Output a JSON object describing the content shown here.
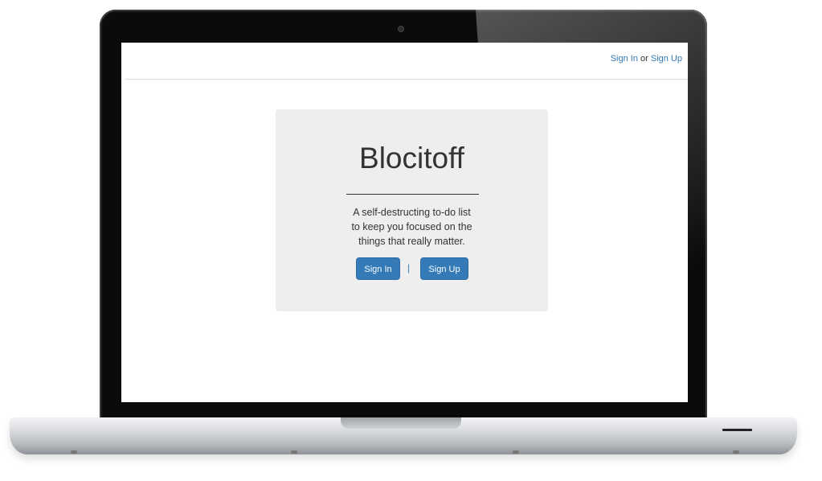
{
  "header": {
    "signin_link": "Sign In",
    "or_text": "or",
    "signup_link": "Sign Up"
  },
  "hero": {
    "title": "Blocitoff",
    "tagline_lines": [
      "A self-destructing to-do list",
      "to keep you focused on the",
      "things that really matter."
    ],
    "signin_button": "Sign In",
    "separator": "|",
    "signup_button": "Sign Up"
  },
  "colors": {
    "link": "#337ab7",
    "button": "#337ab7",
    "jumbotron_bg": "#eeeeee"
  }
}
